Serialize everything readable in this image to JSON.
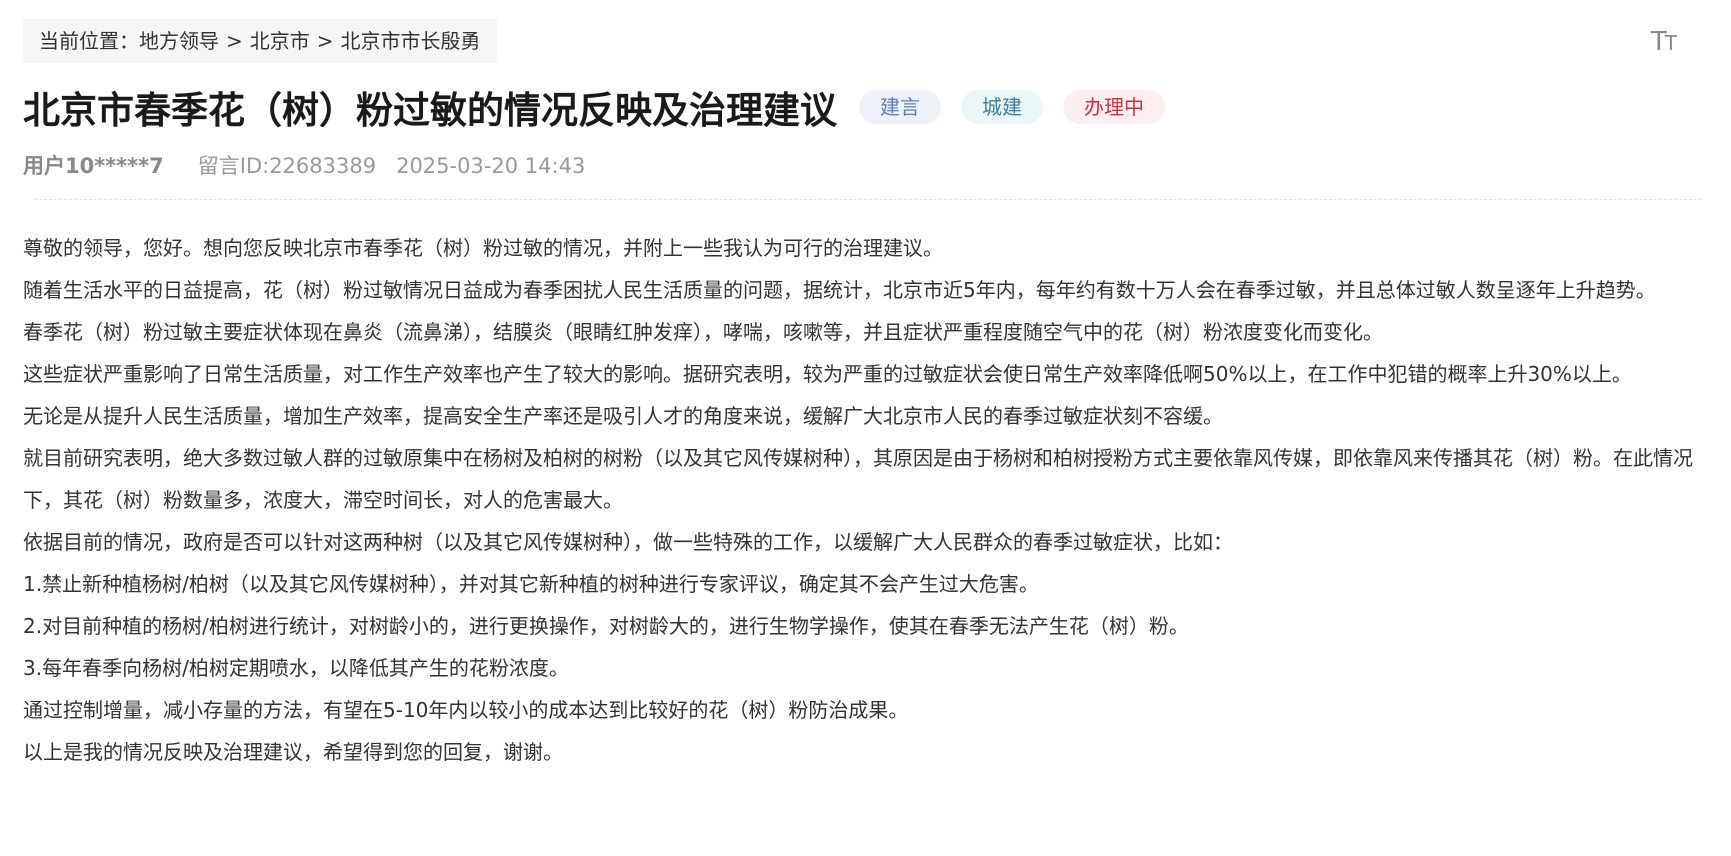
{
  "breadcrumb": {
    "prefix": "当前位置：",
    "items": [
      "地方领导",
      "北京市",
      "北京市市长殷勇"
    ],
    "separator": ">"
  },
  "toolbar": {
    "font_size_big": "T",
    "font_size_small": "T",
    "font_size_icon": "text-size-icon"
  },
  "article": {
    "title": "北京市春季花（树）粉过敏的情况反映及治理建议",
    "tags": [
      {
        "label": "建言",
        "color": "#5b7fbf",
        "bg": "#eef1f8"
      },
      {
        "label": "城建",
        "color": "#3e7e9a",
        "bg": "#eaf6f7"
      },
      {
        "label": "办理中",
        "color": "#c8343c",
        "bg": "#fdeef0"
      }
    ],
    "user": "用户10*****7",
    "message_id": "留言ID:22683389",
    "datetime": "2025-03-20 14:43",
    "paragraphs": [
      "尊敬的领导，您好。想向您反映北京市春季花（树）粉过敏的情况，并附上一些我认为可行的治理建议。",
      "随着生活水平的日益提高，花（树）粉过敏情况日益成为春季困扰人民生活质量的问题，据统计，北京市近5年内，每年约有数十万人会在春季过敏，并且总体过敏人数呈逐年上升趋势。",
      "春季花（树）粉过敏主要症状体现在鼻炎（流鼻涕），结膜炎（眼睛红肿发痒），哮喘，咳嗽等，并且症状严重程度随空气中的花（树）粉浓度变化而变化。",
      "这些症状严重影响了日常生活质量，对工作生产效率也产生了较大的影响。据研究表明，较为严重的过敏症状会使日常生产效率降低啊50%以上，在工作中犯错的概率上升30%以上。",
      "无论是从提升人民生活质量，增加生产效率，提高安全生产率还是吸引人才的角度来说，缓解广大北京市人民的春季过敏症状刻不容缓。",
      "就目前研究表明，绝大多数过敏人群的过敏原集中在杨树及柏树的树粉（以及其它风传媒树种），其原因是由于杨树和柏树授粉方式主要依靠风传媒，即依靠风来传播其花（树）粉。在此情况下，其花（树）粉数量多，浓度大，滞空时间长，对人的危害最大。",
      "依据目前的情况，政府是否可以针对这两种树（以及其它风传媒树种），做一些特殊的工作，以缓解广大人民群众的春季过敏症状，比如：",
      "1.禁止新种植杨树/柏树（以及其它风传媒树种），并对其它新种植的树种进行专家评议，确定其不会产生过大危害。",
      "2.对目前种植的杨树/柏树进行统计，对树龄小的，进行更换操作，对树龄大的，进行生物学操作，使其在春季无法产生花（树）粉。",
      "3.每年春季向杨树/柏树定期喷水，以降低其产生的花粉浓度。",
      "通过控制增量，减小存量的方法，有望在5-10年内以较小的成本达到比较好的花（树）粉防治成果。",
      "以上是我的情况反映及治理建议，希望得到您的回复，谢谢。"
    ]
  }
}
